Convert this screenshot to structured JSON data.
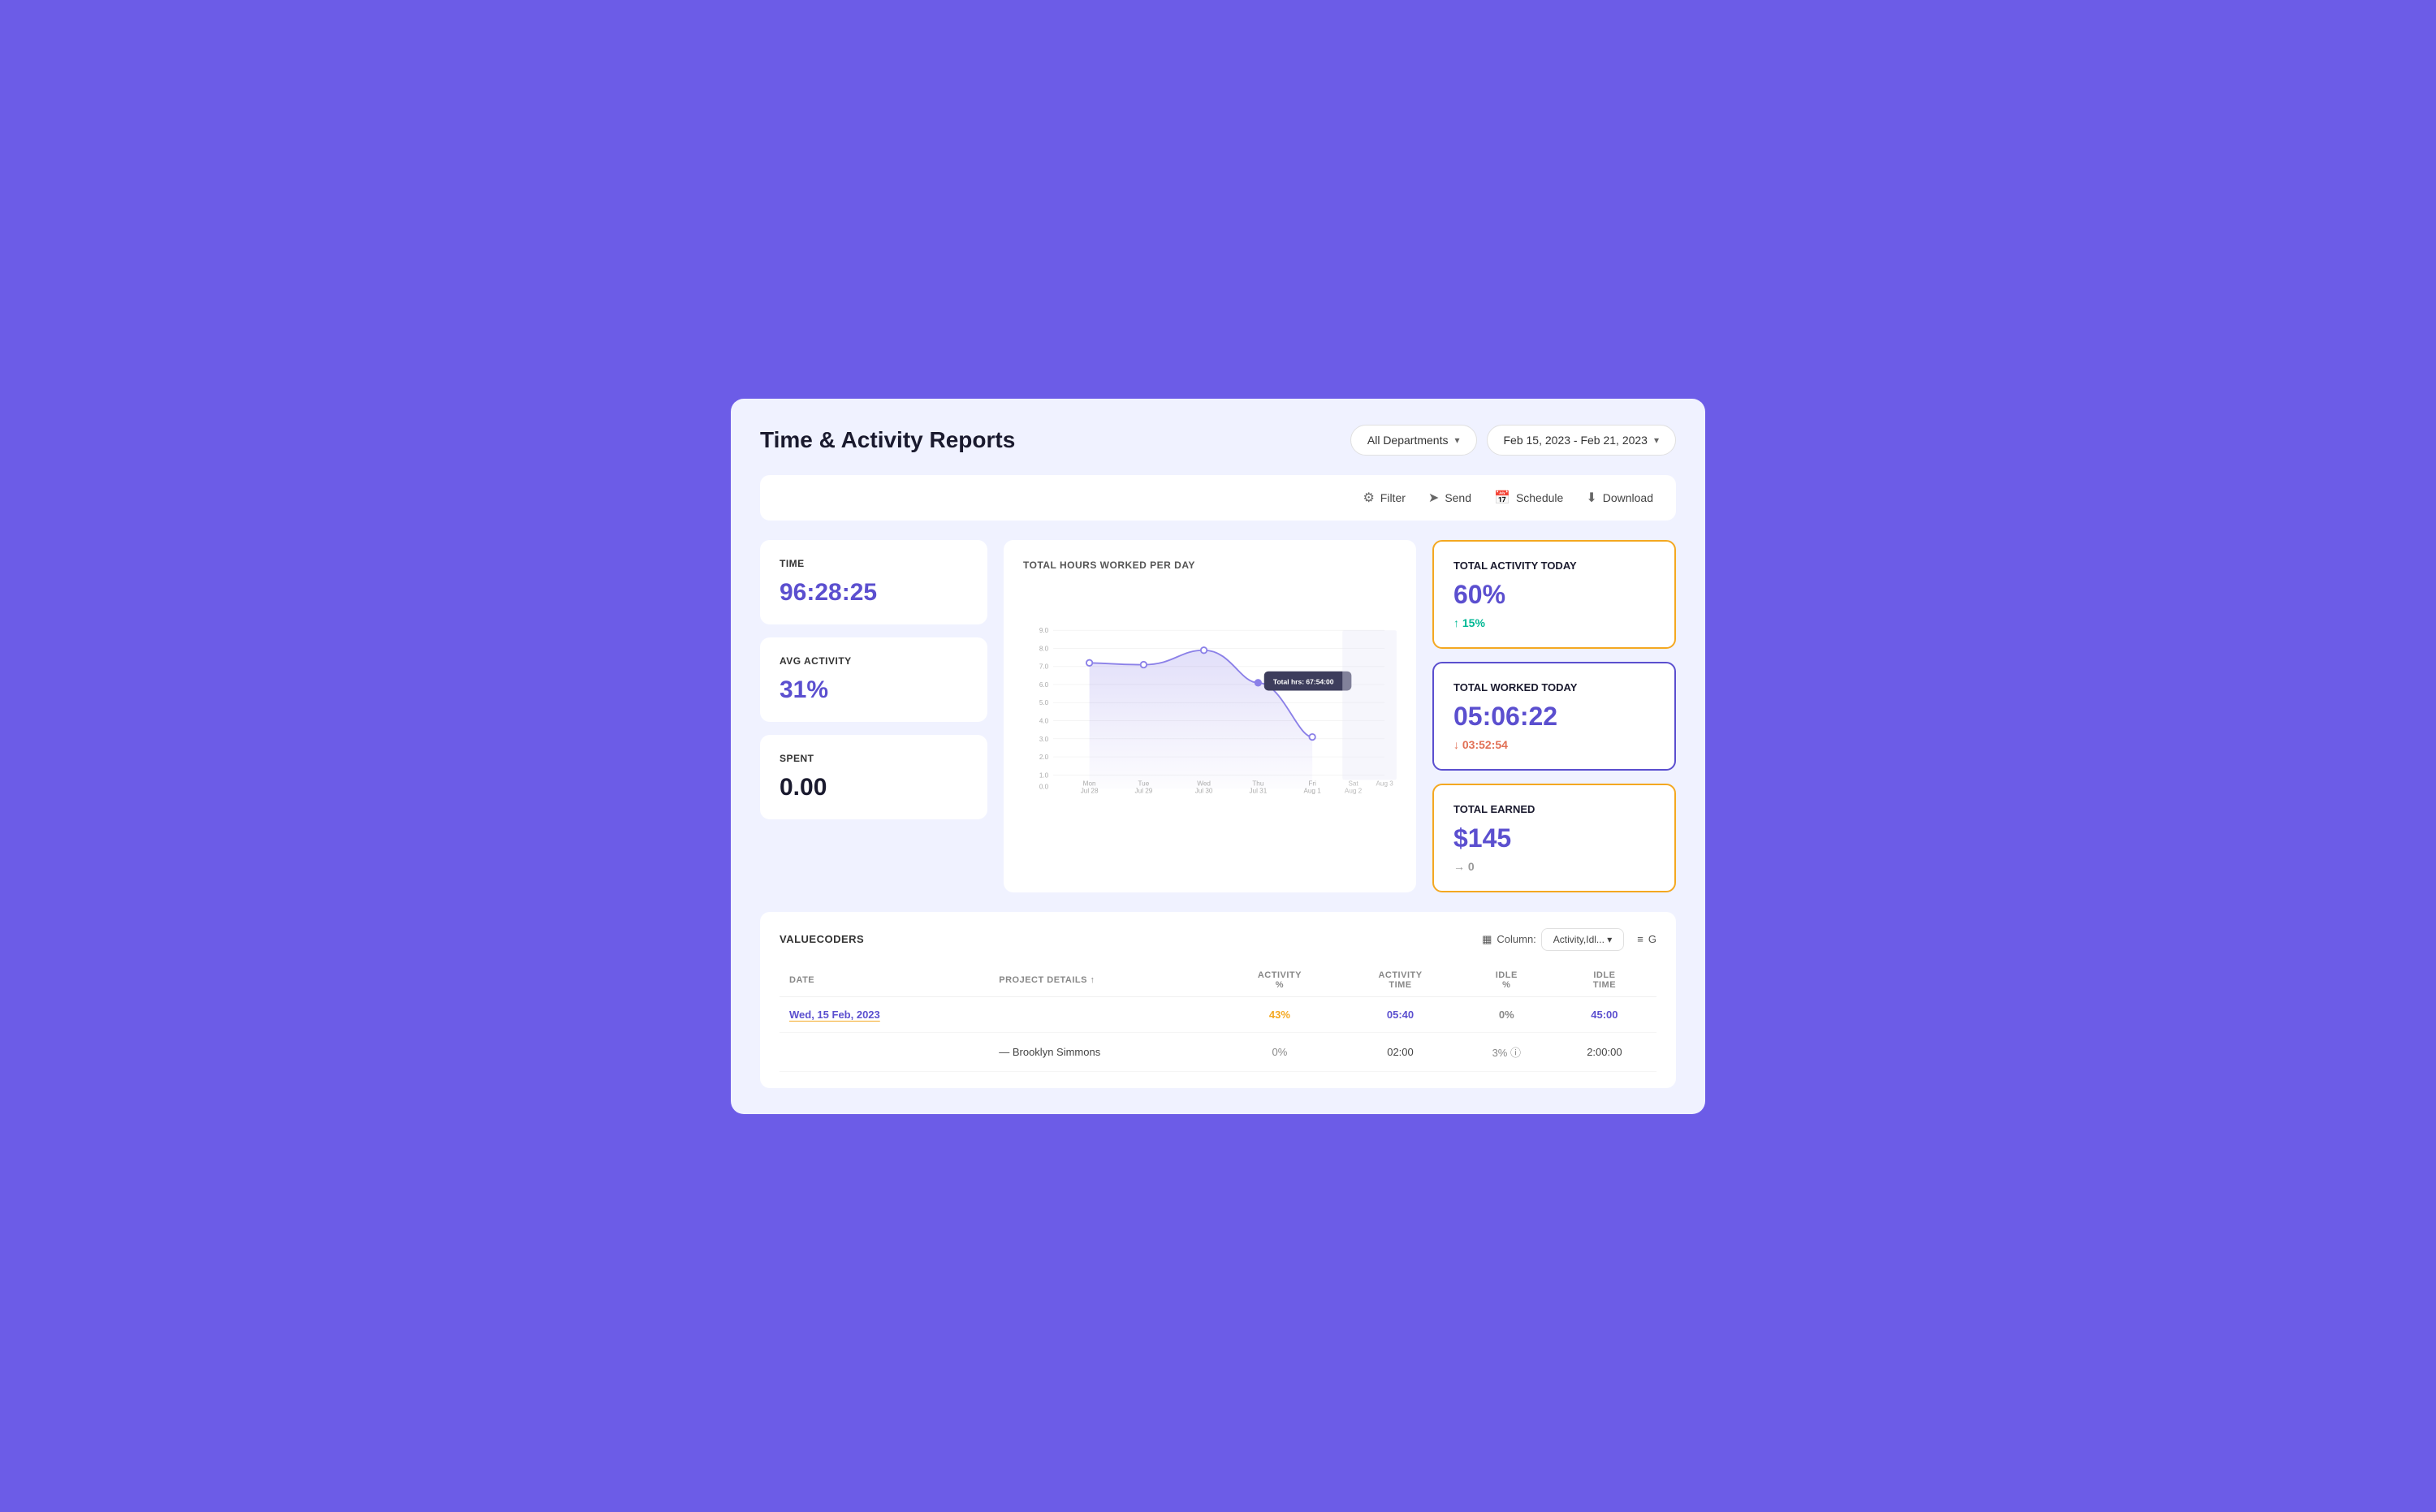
{
  "page": {
    "title": "Time & Activity Reports"
  },
  "header": {
    "department_btn": "All Departments",
    "date_range_btn": "Feb 15, 2023 - Feb 21, 2023"
  },
  "toolbar": {
    "filter_label": "Filter",
    "send_label": "Send",
    "schedule_label": "Schedule",
    "download_label": "Download"
  },
  "stats": {
    "time_label": "TIME",
    "time_value": "96:28:25",
    "avg_label": "AVG ACTIVITY",
    "avg_value": "31%",
    "spent_label": "SPENT",
    "spent_value": "0.00"
  },
  "chart": {
    "title": "TOTAL HOURS WORKED PER DAY",
    "tooltip": "Total hrs: 67:54:00",
    "x_labels": [
      "Mon\nJul 28",
      "Tue\nJul 29",
      "Wed\nJul 30",
      "Thu\nJul 31",
      "Fri\nAug 1",
      "Sat\nAug 2",
      "Aug 3"
    ],
    "y_labels": [
      "9.0",
      "8.0",
      "7.0",
      "6.0",
      "5.0",
      "4.0",
      "3.0",
      "2.0",
      "1.0",
      "0.0"
    ],
    "data_points": [
      7.2,
      7.1,
      7.9,
      6.1,
      3.1
    ]
  },
  "right_cards": {
    "activity_today": {
      "label": "TOTAL ACTIVITY TODAY",
      "value": "60%",
      "sub": "↑ 15%",
      "sub_type": "green"
    },
    "worked_today": {
      "label": "TOTAL WORKED TODAY",
      "value": "05:06:22",
      "sub": "↓ 03:52:54",
      "sub_type": "red"
    },
    "earned": {
      "label": "TOTAL EARNED",
      "value": "$145",
      "sub": "→ 0",
      "sub_type": "gray"
    }
  },
  "table": {
    "org_name": "VALUECODERS",
    "column_label": "Column:",
    "column_value": "Activity,Idl...",
    "group_label": "G",
    "headers": [
      "DATE",
      "PROJECT DETAILS ↑",
      "ACTIVITY\n%",
      "ACTIVITY\nTIME",
      "IDLE\n%",
      "IDLE\nTIME"
    ],
    "rows": [
      {
        "type": "date",
        "date": "Wed, 15 Feb, 2023",
        "project": "",
        "act_pct": "43%",
        "act_time": "05:40",
        "idle_pct": "0%",
        "idle_time": "45:00"
      },
      {
        "type": "member",
        "date": "",
        "project": "— Brooklyn Simmons",
        "act_pct": "0%",
        "act_time": "02:00",
        "idle_pct": "3%",
        "idle_time": "2:00:00"
      }
    ]
  }
}
